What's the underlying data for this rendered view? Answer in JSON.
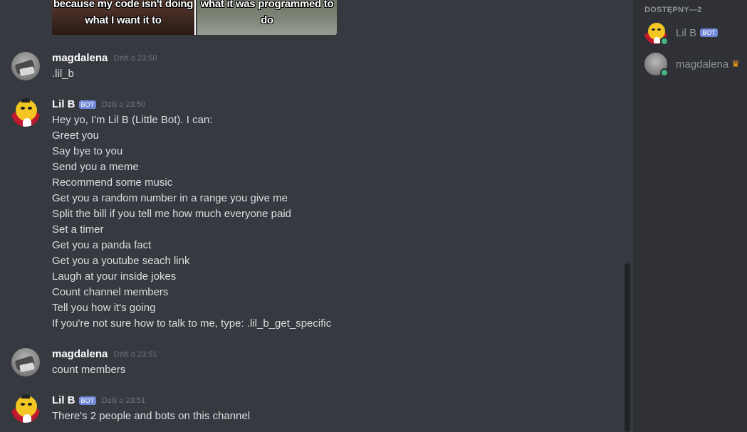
{
  "meme": {
    "left_text": "because my code isn't doing what I want it to",
    "right_text": "what it was programmed to do"
  },
  "messages": [
    {
      "author": "magdalena",
      "timestamp": "Dziś o 23:50",
      "lines": [
        ".lil_b"
      ]
    },
    {
      "author": "Lil B",
      "bot_tag": "BOT",
      "timestamp": "Dziś o 23:50",
      "lines": [
        "Hey yo, I'm Lil B (Little Bot). I can:",
        "Greet you",
        "Say bye to you",
        "Send you a meme",
        "Recommend some music",
        "Get you a random number in a range you give me",
        "Split the bill if you tell me how much everyone paid",
        "Set a timer",
        "Get you a panda fact",
        "Get you a youtube seach link",
        "Laugh at your inside jokes",
        "Count channel members",
        "Tell you how it's going",
        "If you're not sure how to talk to me, type: .lil_b_get_specific"
      ]
    },
    {
      "author": "magdalena",
      "timestamp": "Dziś o 23:51",
      "lines": [
        "count members"
      ]
    },
    {
      "author": "Lil B",
      "bot_tag": "BOT",
      "timestamp": "Dziś o 23:51",
      "lines": [
        "There's 2 people and bots on this channel"
      ]
    }
  ],
  "members": {
    "section_title": "DOSTĘPNY—2",
    "list": [
      {
        "name": "Lil B",
        "bot_tag": "BOT",
        "status_color": "#43b581"
      },
      {
        "name": "magdalena",
        "owner_icon": "crown-icon",
        "status_color": "#43b581"
      }
    ]
  },
  "colors": {
    "background": "#36393f",
    "sidebar": "#2f3136",
    "bot_tag": "#7289da",
    "online": "#43b581",
    "crown": "#faa61a"
  }
}
